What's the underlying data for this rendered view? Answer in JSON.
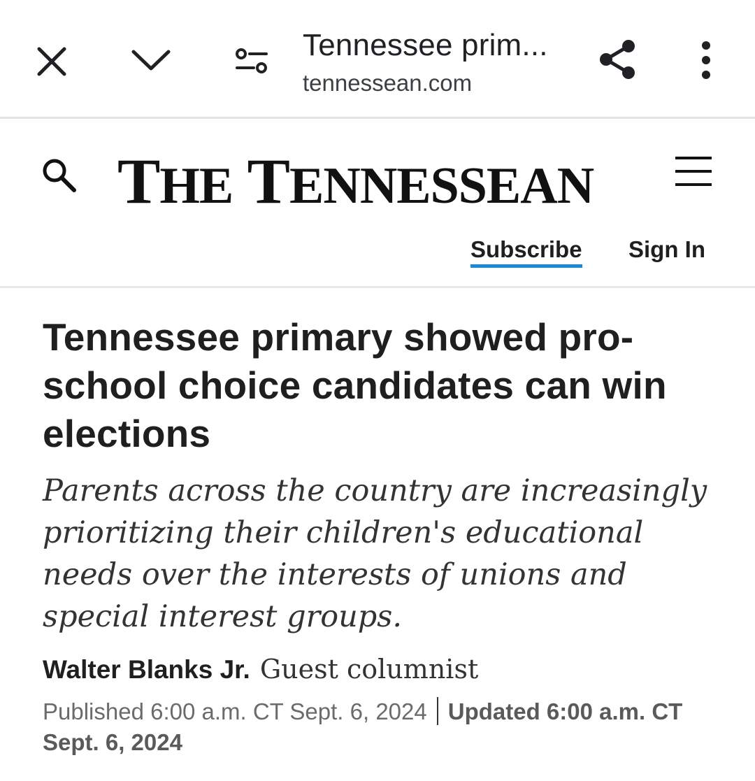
{
  "browser": {
    "page_title": "Tennessee prim...",
    "domain": "tennessean.com",
    "icons": [
      "close-icon",
      "chevron-down-icon",
      "page-settings-icon",
      "share-icon",
      "more-vertical-icon"
    ]
  },
  "site": {
    "masthead_the": "T",
    "masthead_he": "HE",
    "masthead_t": "T",
    "masthead_ennessean": "ENNESSEAN",
    "subscribe_label": "Subscribe",
    "signin_label": "Sign In",
    "accent_color": "#1a8ad6"
  },
  "article": {
    "headline": "Tennessee primary showed pro-school choice candidates can win elections",
    "dek": "Parents across the country are increasingly prioritizing their children's educational needs over the interests of unions and special interest groups.",
    "author": "Walter Blanks Jr.",
    "role": "Guest columnist",
    "published": "Published 6:00 a.m. CT Sept. 6, 2024",
    "updated": "Updated 6:00 a.m. CT Sept. 6, 2024"
  }
}
